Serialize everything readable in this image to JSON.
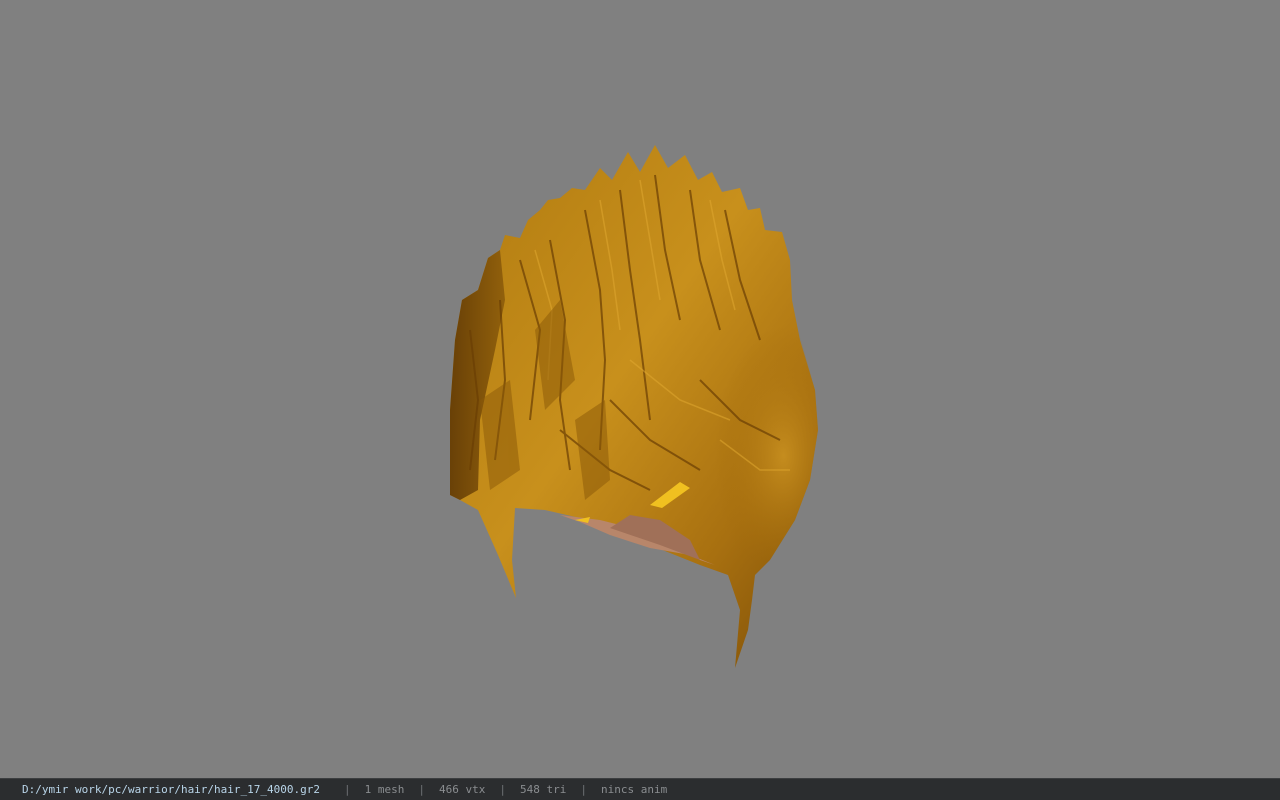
{
  "viewer": {
    "background_color": "#808080",
    "model_colors": {
      "hair_light": "#c8901c",
      "hair_mid": "#a86e0e",
      "hair_dark": "#5a3404",
      "highlight": "#f0c020",
      "skin": "#b8866a"
    }
  },
  "status_bar": {
    "file_path": "D:/ymir work/pc/warrior/hair/hair_17_4000.gr2",
    "separator": "|",
    "mesh_count": "1 mesh",
    "vertex_count": "466 vtx",
    "triangle_count": "548 tri",
    "anim_status": "nincs anim"
  }
}
